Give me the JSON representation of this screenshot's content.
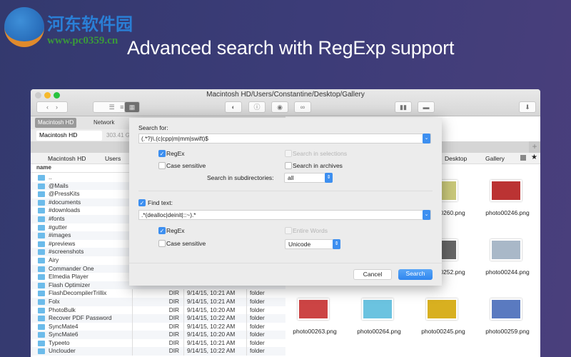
{
  "watermark": {
    "cn": "河东软件园",
    "url": "www.pc0359.cn"
  },
  "headline": "Advanced search with RegExp support",
  "window": {
    "title": "Macintosh HD/Users/Constantine/Desktop/Gallery",
    "tabs": [
      "Macintosh HD",
      "Network"
    ],
    "drive": {
      "name": "Macintosh HD",
      "free": "303.41 G"
    },
    "breadcrumb_left": [
      "Macintosh HD",
      "Users"
    ],
    "breadcrumb_right": [
      "Desktop",
      "Gallery"
    ],
    "column_name": "name",
    "files": [
      {
        "name": ".."
      },
      {
        "name": "@Mails"
      },
      {
        "name": "@PressKits"
      },
      {
        "name": "#documents"
      },
      {
        "name": "#downloads"
      },
      {
        "name": "#fonts"
      },
      {
        "name": "#gutter"
      },
      {
        "name": "#images"
      },
      {
        "name": "#previews"
      },
      {
        "name": "#screenshots"
      },
      {
        "name": "Airy"
      },
      {
        "name": "Commander One"
      },
      {
        "name": "Elmedia Player"
      },
      {
        "name": "Flash Optimizer"
      },
      {
        "name": "FlashDecompilerTrillix",
        "size": "DIR",
        "date": "9/14/15, 10:21 AM",
        "kind": "folder"
      },
      {
        "name": "Folx",
        "size": "DIR",
        "date": "9/14/15, 10:21 AM",
        "kind": "folder"
      },
      {
        "name": "PhotoBulk",
        "size": "DIR",
        "date": "9/14/15, 10:20 AM",
        "kind": "folder"
      },
      {
        "name": "Recover PDF Password",
        "size": "DIR",
        "date": "9/14/15, 10:22 AM",
        "kind": "folder"
      },
      {
        "name": "SyncMate4",
        "size": "DIR",
        "date": "9/14/15, 10:22 AM",
        "kind": "folder"
      },
      {
        "name": "SyncMate6",
        "size": "DIR",
        "date": "9/14/15, 10:20 AM",
        "kind": "folder"
      },
      {
        "name": "Typeeto",
        "size": "DIR",
        "date": "9/14/15, 10:21 AM",
        "kind": "folder"
      },
      {
        "name": "Unclouder",
        "size": "DIR",
        "date": "9/14/15, 10:22 AM",
        "kind": "folder"
      }
    ],
    "photos": [
      "photo00260.png",
      "photo00246.png",
      "photo00252.png",
      "photo00244.png",
      "photo00263.png",
      "photo00264.png",
      "photo00245.png",
      "photo00259.png"
    ]
  },
  "dialog": {
    "search_for_label": "Search for:",
    "search_for_value": "(.*?)\\.(c|cpp|m|mm|swift)$",
    "regex1": "RegEx",
    "case1": "Case sensitive",
    "in_selections": "Search in selections",
    "in_archives": "Search in archives",
    "subdirs_label": "Search in subdirectories:",
    "subdirs_value": "all",
    "find_text_label": "Find text:",
    "find_text_value": ".*(dealloc|deinit|::~).*",
    "regex2": "RegEx",
    "case2": "Case sensitive",
    "entire_words": "Entire Words",
    "encoding": "Unicode",
    "cancel": "Cancel",
    "search": "Search"
  }
}
